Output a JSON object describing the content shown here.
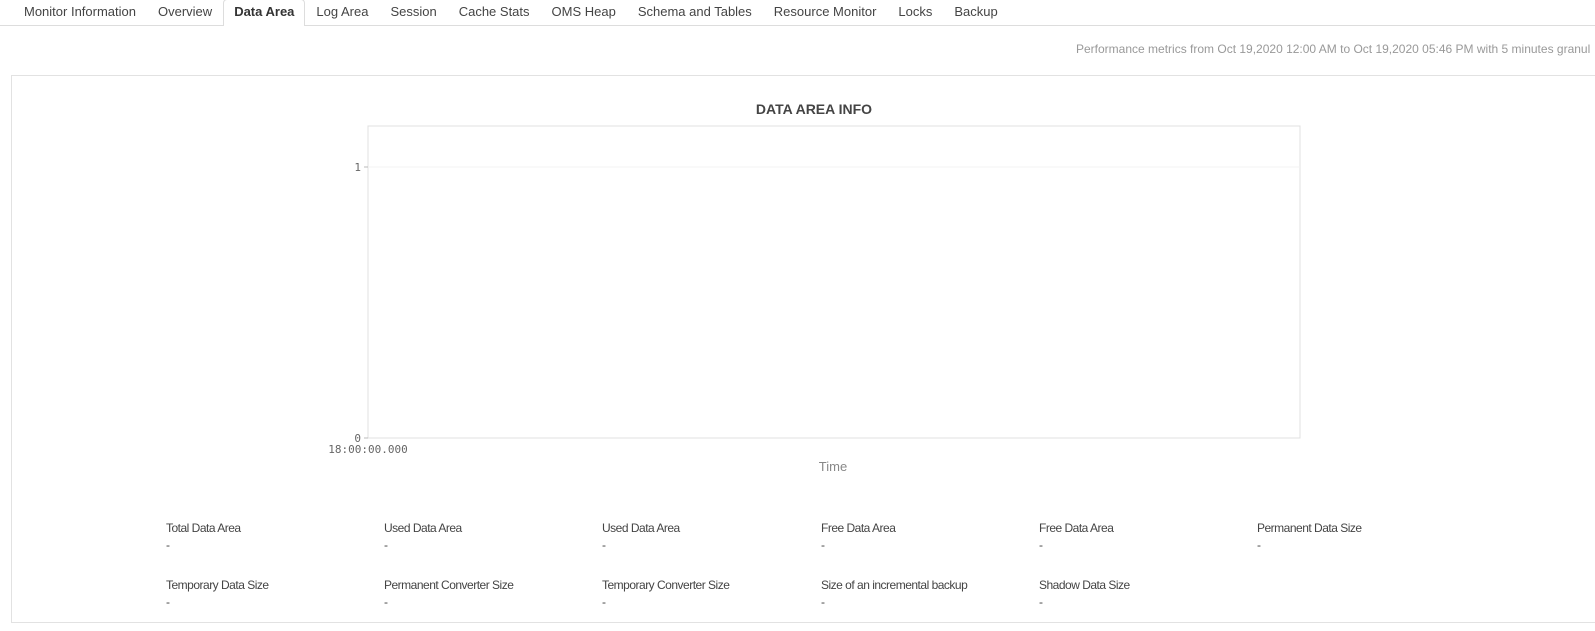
{
  "tabs": [
    {
      "label": "Monitor Information"
    },
    {
      "label": "Overview"
    },
    {
      "label": "Data Area",
      "active": true
    },
    {
      "label": "Log Area"
    },
    {
      "label": "Session"
    },
    {
      "label": "Cache Stats"
    },
    {
      "label": "OMS Heap"
    },
    {
      "label": "Schema and Tables"
    },
    {
      "label": "Resource Monitor"
    },
    {
      "label": "Locks"
    },
    {
      "label": "Backup"
    }
  ],
  "metrics_note": "Performance metrics from Oct 19,2020 12:00 AM to Oct 19,2020 05:46 PM with 5 minutes granul",
  "chart_data": {
    "type": "line",
    "title": "DATA AREA INFO",
    "xlabel": "Time",
    "ylabel": "",
    "x_ticks": [
      "18:00:00.000"
    ],
    "y_ticks": [
      "0",
      "1"
    ],
    "ylim": [
      0,
      1
    ],
    "series": []
  },
  "stats": [
    {
      "label": "Total Data Area",
      "value": "-"
    },
    {
      "label": "Used Data Area",
      "value": "-"
    },
    {
      "label": "Used Data Area",
      "value": "-"
    },
    {
      "label": "Free Data Area",
      "value": "-"
    },
    {
      "label": "Free Data Area",
      "value": "-"
    },
    {
      "label": "Permanent Data Size",
      "value": "-"
    },
    {
      "label": "Temporary Data Size",
      "value": "-"
    },
    {
      "label": "Permanent Converter Size",
      "value": "-"
    },
    {
      "label": "Temporary Converter Size",
      "value": "-"
    },
    {
      "label": "Size of an incremental backup",
      "value": "-"
    },
    {
      "label": "Shadow Data Size",
      "value": "-"
    }
  ]
}
